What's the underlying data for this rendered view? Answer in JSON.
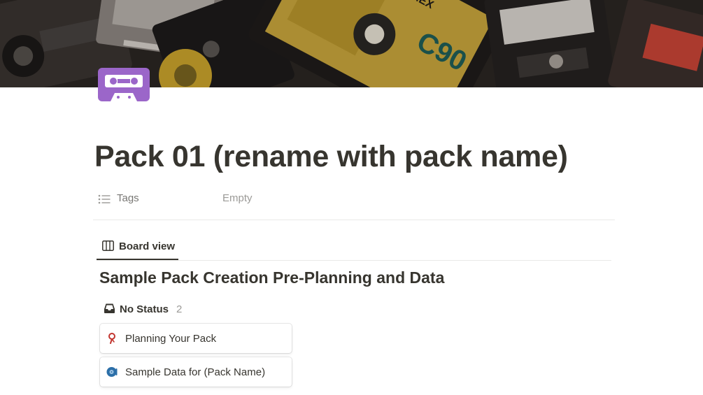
{
  "page": {
    "title": "Pack 01 (rename with pack name)",
    "cover": "cassette-tapes-photo",
    "icon": "cassette-icon",
    "icon_color": "#9b66c9"
  },
  "properties": [
    {
      "icon": "list-icon",
      "label": "Tags",
      "value": "Empty"
    }
  ],
  "views": [
    {
      "icon": "board-view-icon",
      "label": "Board view",
      "active": true
    }
  ],
  "database": {
    "title": "Sample Pack Creation Pre-Planning and Data",
    "groups": [
      {
        "icon": "inbox-icon",
        "name": "No Status",
        "count": "2",
        "cards": [
          {
            "icon": "map-pin-icon",
            "title": "Planning Your Pack"
          },
          {
            "icon": "vinyl-disc-icon",
            "title": "Sample Data for (Pack Name)"
          }
        ]
      }
    ]
  },
  "colors": {
    "text": "#37352f",
    "muted": "#9b9a97",
    "divider": "#e9e9e7",
    "pin": "#c2352f",
    "disc": "#2c6fa8"
  }
}
